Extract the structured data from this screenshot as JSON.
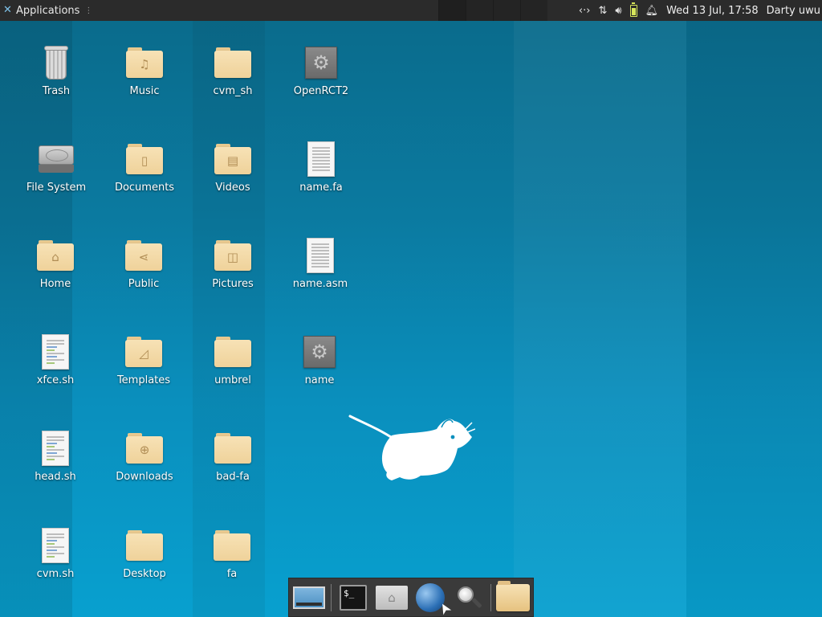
{
  "panel": {
    "applications_label": "Applications",
    "datetime": "Wed 13 Jul, 17:58",
    "user": "Darty uwu"
  },
  "desktop_icons": {
    "trash": "Trash",
    "file_system": "File System",
    "home": "Home",
    "xfce_sh": "xfce.sh",
    "head_sh": "head.sh",
    "cvm_sh_file": "cvm.sh",
    "music": "Music",
    "documents": "Documents",
    "public": "Public",
    "templates": "Templates",
    "downloads": "Downloads",
    "desktop": "Desktop",
    "cvm_sh_folder": "cvm_sh",
    "videos": "Videos",
    "pictures": "Pictures",
    "umbrel": "umbrel",
    "bad_fa": "bad-fa",
    "fa": "fa",
    "openrct2": "OpenRCT2",
    "name_fa": "name.fa",
    "name_asm": "name.asm",
    "name": "name"
  },
  "dock": {
    "terminal_glyph": "$_"
  }
}
